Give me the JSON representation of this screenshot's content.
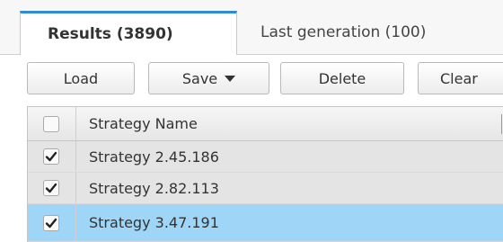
{
  "tabs": [
    {
      "label": "Results (3890)",
      "active": true
    },
    {
      "label": "Last generation (100)",
      "active": false
    }
  ],
  "toolbar": {
    "load_label": "Load",
    "save_label": "Save",
    "delete_label": "Delete",
    "clear_label": "Clear"
  },
  "grid": {
    "header": {
      "name_label": "Strategy Name",
      "checked": false
    },
    "rows": [
      {
        "name": "Strategy 2.45.186",
        "checked": true,
        "selected": false
      },
      {
        "name": "Strategy 2.82.113",
        "checked": true,
        "selected": false
      },
      {
        "name": "Strategy 3.47.191",
        "checked": true,
        "selected": true
      }
    ]
  },
  "colors": {
    "accent": "#2f8ad8",
    "selected_row": "#9fd5f6",
    "checked_row": "#e4e4e4"
  }
}
